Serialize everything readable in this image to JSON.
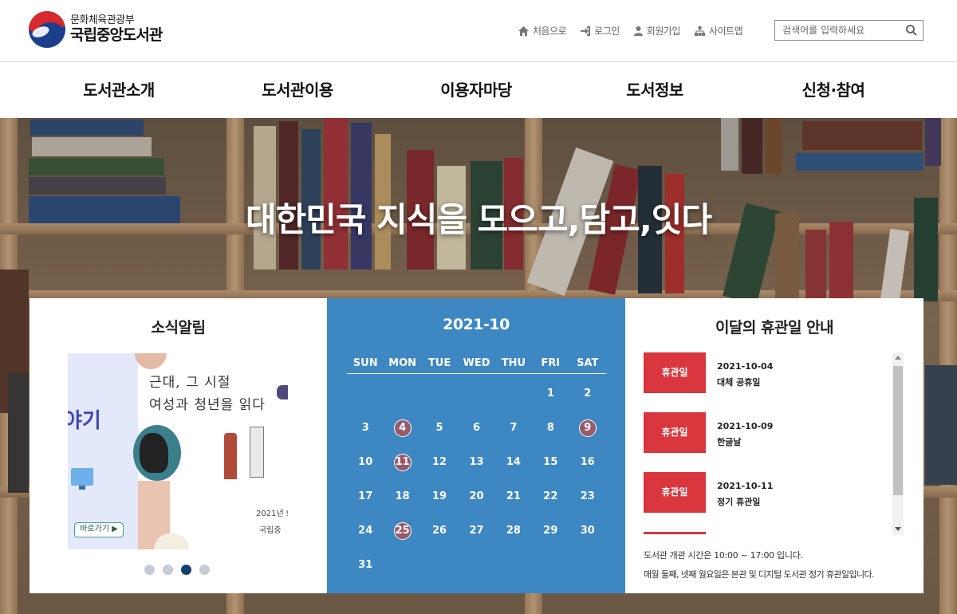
{
  "brand": {
    "ministry": "문화체육관광부",
    "name": "국립중앙도서관"
  },
  "utils": [
    {
      "label": "처음으로",
      "icon": "home-icon"
    },
    {
      "label": "로그인",
      "icon": "login-icon"
    },
    {
      "label": "회원가입",
      "icon": "user-icon"
    },
    {
      "label": "사이트맵",
      "icon": "sitemap-icon"
    }
  ],
  "search": {
    "placeholder": "검색어를 입력하세요",
    "value": ""
  },
  "gnb": [
    "도서관소개",
    "도서관이용",
    "이용자마당",
    "도서정보",
    "신청·참여"
  ],
  "hero": {
    "title": "대한민국 지식을 모으고,담고,잇다"
  },
  "news": {
    "title": "소식알림",
    "banner": {
      "left_text": "야기",
      "button": "바로가기 ▶",
      "line1": "근대, 그 시절",
      "line2": "여성과 청년을 읽다",
      "date": "2021년 9",
      "org": "국립중"
    },
    "slides": 4,
    "active_slide": 3
  },
  "calendar": {
    "title": "2021-10",
    "weekdays": [
      "SUN",
      "MON",
      "TUE",
      "WED",
      "THU",
      "FRI",
      "SAT"
    ],
    "days": [
      "",
      "",
      "",
      "",
      "",
      "1",
      "2",
      "3",
      "4",
      "5",
      "6",
      "7",
      "8",
      "9",
      "10",
      "11",
      "12",
      "13",
      "14",
      "15",
      "16",
      "17",
      "18",
      "19",
      "20",
      "21",
      "22",
      "23",
      "24",
      "25",
      "26",
      "27",
      "28",
      "29",
      "30",
      "31"
    ],
    "holidays": [
      "4",
      "9",
      "11",
      "25"
    ]
  },
  "holidays": {
    "title": "이달의 휴관일 안내",
    "items": [
      {
        "badge": "휴관일",
        "date": "2021-10-04",
        "name": "대체 공휴일"
      },
      {
        "badge": "휴관일",
        "date": "2021-10-09",
        "name": "한글날"
      },
      {
        "badge": "휴관일",
        "date": "2021-10-11",
        "name": "정기 휴관일"
      }
    ],
    "note1": "도서관 개관 시간은 10:00 ~ 17:00 입니다.",
    "note2": "매월 둘째, 넷째 월요일은 본관 및 디지털 도서관 정기 휴관일입니다."
  },
  "colors": {
    "calendar_bg": "#3d87c3",
    "holiday_red": "#d9363e",
    "holiday_circle": "#985a6a",
    "active_dot": "#16406b"
  }
}
